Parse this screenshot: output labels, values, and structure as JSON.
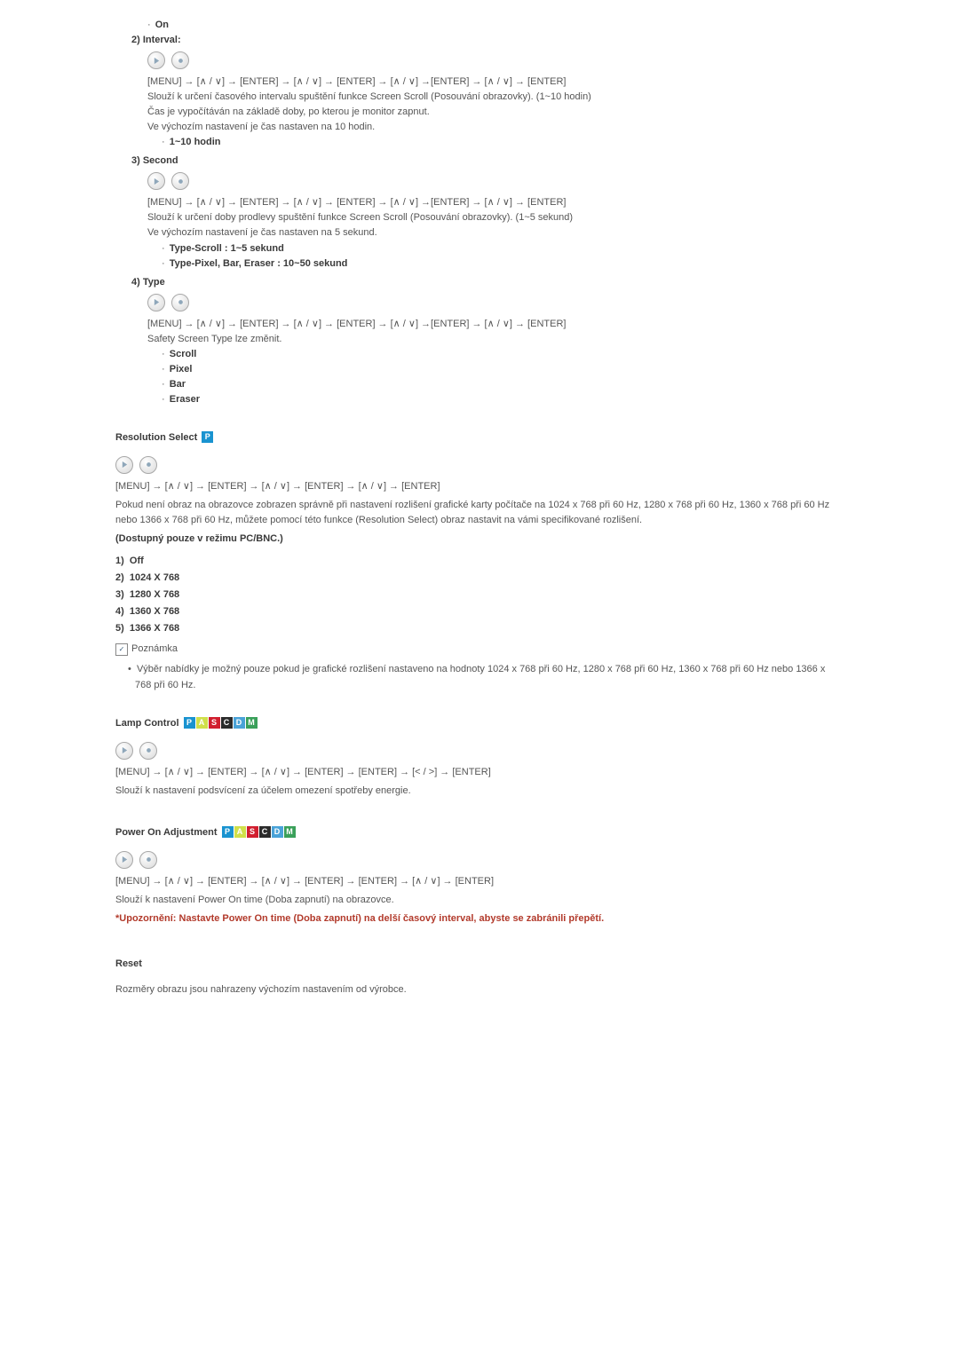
{
  "item_on": {
    "label": "On"
  },
  "interval": {
    "num": "2)",
    "label": "Interval:",
    "path": "[MENU] → [∧ / ∨] → [ENTER] → [∧ / ∨] → [ENTER] → [∧ / ∨] →[ENTER] → [∧ / ∨] → [ENTER]",
    "p1": "Slouží k určení časového intervalu spuštění funkce Screen Scroll (Posouvání obrazovky). (1~10 hodin)",
    "p2": "Čas je vypočítáván na základě doby, po kterou je monitor zapnut.",
    "p3": "Ve výchozím nastavení je čas nastaven na 10 hodin.",
    "opt1": "1~10 hodin"
  },
  "second": {
    "num": "3)",
    "label": "Second",
    "path": "[MENU] → [∧ / ∨] → [ENTER] → [∧ / ∨] → [ENTER] → [∧ / ∨] →[ENTER] → [∧ / ∨] → [ENTER]",
    "p1": "Slouží k určení doby prodlevy spuštění funkce Screen Scroll (Posouvání obrazovky). (1~5 sekund)",
    "p2": "Ve výchozím nastavení je čas nastaven na 5 sekund.",
    "opt1": "Type-Scroll : 1~5 sekund",
    "opt2": "Type-Pixel, Bar, Eraser : 10~50 sekund"
  },
  "type": {
    "num": "4)",
    "label": "Type",
    "path": "[MENU] → [∧ / ∨] → [ENTER] → [∧ / ∨] → [ENTER] → [∧ / ∨] →[ENTER] → [∧ / ∨] → [ENTER]",
    "p1": "Safety Screen Type lze změnit.",
    "opt1": "Scroll",
    "opt2": "Pixel",
    "opt3": "Bar",
    "opt4": "Eraser"
  },
  "resolution": {
    "title": "Resolution Select",
    "path": "[MENU] → [∧ / ∨] → [ENTER] → [∧ / ∨] → [ENTER] → [∧ / ∨] → [ENTER]",
    "p1": "Pokud není obraz na obrazovce zobrazen správně při nastavení rozlišení grafické karty počítače na 1024 x 768 při 60 Hz, 1280 x 768 při 60 Hz, 1360 x 768 při 60 Hz nebo 1366 x 768 při 60 Hz, můžete pomocí této funkce (Resolution Select) obraz nastavit na vámi specifikované rozlišení.",
    "avail": "(Dostupný pouze v režimu PC/BNC.)",
    "opts": {
      "1": "Off",
      "2": "1024 X 768",
      "3": "1280 X 768",
      "4": "1360 X 768",
      "5": "1366 X 768"
    },
    "noteLabel": "Poznámka",
    "note": "Výběr nabídky je možný pouze pokud je grafické rozlišení nastaveno na hodnoty 1024 x 768 při 60 Hz, 1280 x 768 při 60 Hz, 1360 x 768 při 60 Hz nebo 1366 x 768 při 60 Hz."
  },
  "lamp": {
    "title": "Lamp Control",
    "path": "[MENU] → [∧ / ∨] → [ENTER] → [∧ / ∨] → [ENTER] → [ENTER] → [< / >] → [ENTER]",
    "p1": "Slouží k nastavení podsvícení za účelem omezení spotřeby energie."
  },
  "power": {
    "title": "Power On Adjustment",
    "path": "[MENU] → [∧ / ∨] → [ENTER] → [∧ / ∨] → [ENTER] → [ENTER] → [∧ / ∨] → [ENTER]",
    "p1": "Slouží k nastavení Power On time (Doba zapnutí) na obrazovce.",
    "warn": "*Upozornění: Nastavte Power On time (Doba zapnutí) na delší časový interval, abyste se zabránili přepětí."
  },
  "reset": {
    "title": "Reset",
    "p1": "Rozměry obrazu jsou nahrazeny výchozím nastavením od výrobce."
  },
  "badges": {
    "P": "P",
    "A": "A",
    "S": "S",
    "C": "C",
    "D": "D",
    "M": "M"
  }
}
